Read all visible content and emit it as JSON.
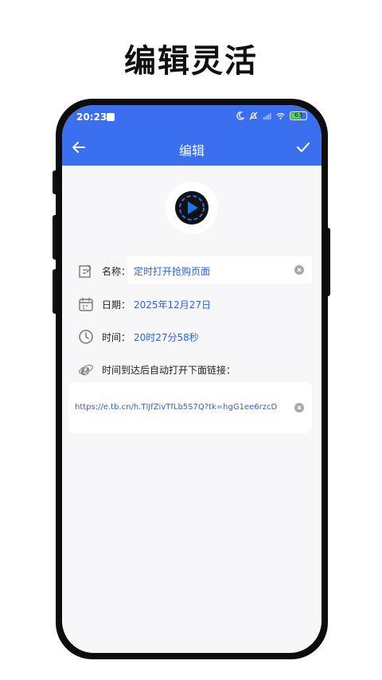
{
  "headline": "编辑灵活",
  "status": {
    "time": "20:23",
    "battery": "63"
  },
  "appbar": {
    "title": "编辑"
  },
  "form": {
    "name_label": "名称：",
    "name_value": "定时打开抢购页面",
    "date_label": "日期：",
    "date_value": "2025年12月27日",
    "time_label": "时间：",
    "time_value": "20时27分58秒",
    "link_label": "时间到达后自动打开下面链接：",
    "url_value": "https://e.tb.cn/h.TlJfZivTfLb5S7Q?tk=hgG1ee6rzcD"
  },
  "colors": {
    "accent": "#3a6ff0",
    "value_text": "#2c64d8",
    "logo_blue": "#1e73e8"
  },
  "icons": [
    "wrench-icon",
    "moon-icon",
    "mute-icon",
    "signal-icon",
    "wifi-icon",
    "battery-icon",
    "back-arrow-icon",
    "check-icon",
    "play-logo-icon",
    "edit-note-icon",
    "calendar-icon",
    "clock-icon",
    "browser-e-icon",
    "clear-icon"
  ]
}
